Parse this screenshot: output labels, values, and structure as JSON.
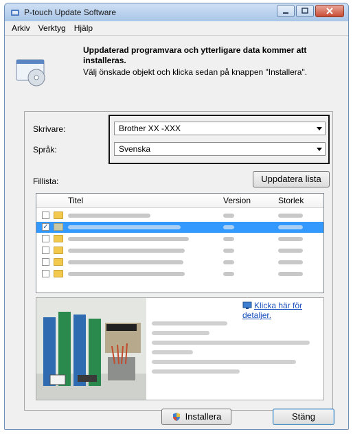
{
  "window": {
    "title": "P-touch Update Software"
  },
  "menu": [
    "Arkiv",
    "Verktyg",
    "Hjälp"
  ],
  "header": {
    "bold_text": "Uppdaterad programvara och ytterligare data kommer att installeras.",
    "text": "Välj önskade objekt och klicka sedan på knappen \"Installera\"."
  },
  "form": {
    "printer_label": "Skrivare:",
    "printer_value": "Brother XX -XXX",
    "language_label": "Språk:",
    "language_value": "Svenska",
    "filelist_label": "Fillista:",
    "update_list_button": "Uppdatera lista"
  },
  "filelist": {
    "columns": [
      "Titel",
      "Version",
      "Storlek"
    ],
    "rows": [
      {
        "checked": false,
        "selected": false
      },
      {
        "checked": true,
        "selected": true
      },
      {
        "checked": false,
        "selected": false
      },
      {
        "checked": false,
        "selected": false
      },
      {
        "checked": false,
        "selected": false
      },
      {
        "checked": false,
        "selected": false
      }
    ]
  },
  "preview": {
    "details_link": "Klicka här för detaljer."
  },
  "buttons": {
    "install": "Installera",
    "close": "Stäng"
  },
  "colors": {
    "selection": "#3399ff",
    "link": "#1a4fbf"
  }
}
